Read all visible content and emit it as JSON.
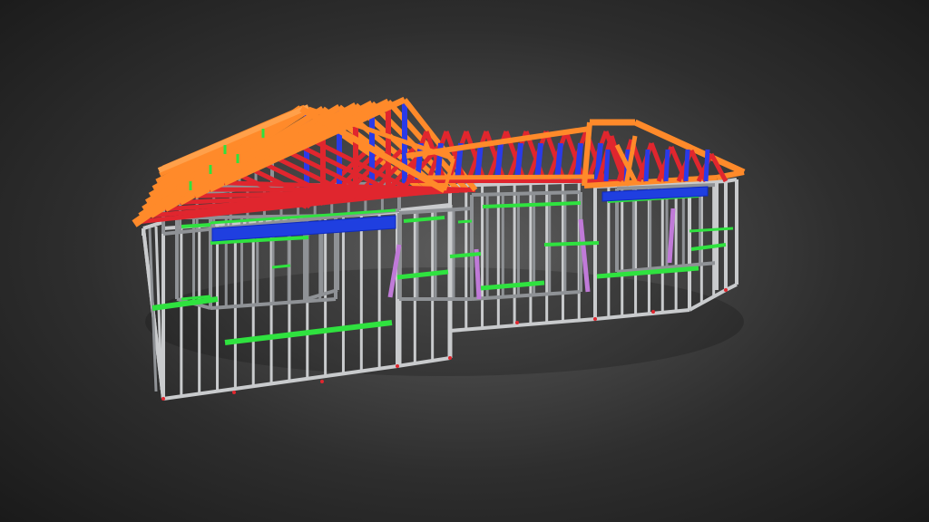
{
  "viewer": {
    "colors": {
      "background_center": "#5c5c5c",
      "background_edge": "#1a1a1a",
      "wall_frame": "#c9cbcd",
      "wall_frame_shadow": "#8f9296",
      "nogging": "#2fe23f",
      "top_plate": "#1f3fe0",
      "truss_chord": "#ff8a2a",
      "truss_web": "#e0262e",
      "truss_web_blue": "#2a3ae8",
      "bracing": "#c07ad8",
      "anchor": "#e0262e"
    }
  },
  "model": {
    "parts": [
      {
        "name": "wall-framing",
        "icon": "steel-stud-frame"
      },
      {
        "name": "noggings",
        "icon": "horizontal-member"
      },
      {
        "name": "top-plates",
        "icon": "lintel-beam"
      },
      {
        "name": "roof-trusses",
        "icon": "truss"
      }
    ]
  }
}
